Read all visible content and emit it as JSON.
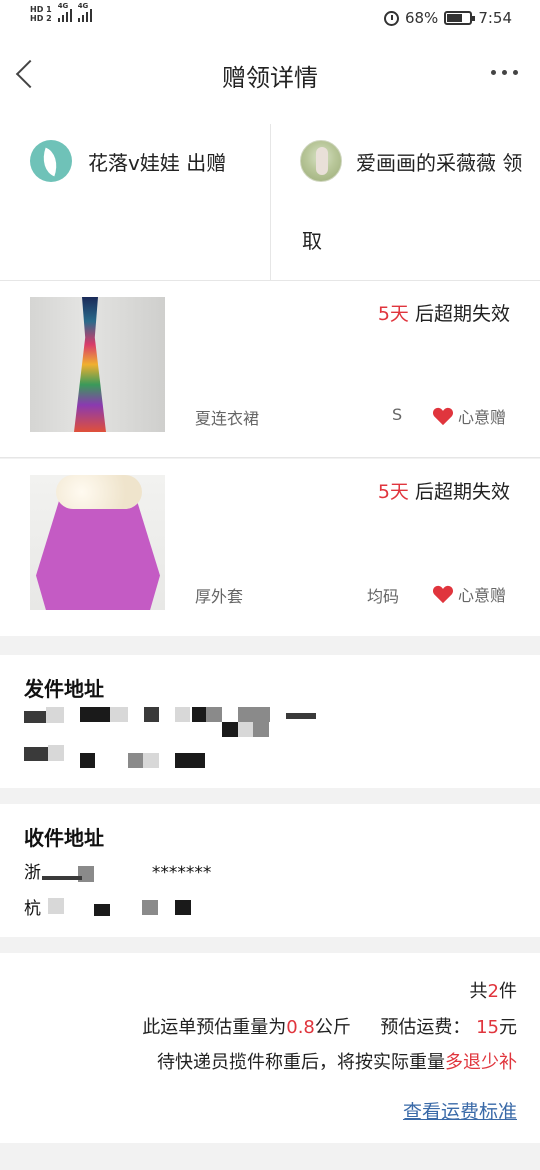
{
  "status": {
    "hd1": "HD 1",
    "hd2": "HD 2",
    "net1": "4G",
    "net2": "4G",
    "battery": "68%",
    "battery_level": 0.68,
    "time": "7:54"
  },
  "nav": {
    "title": "赠领详情"
  },
  "giver": {
    "name": "花落v娃娃",
    "action": "出赠"
  },
  "receiver": {
    "name": "爱画画的采薇薇",
    "action_part1": "领",
    "action_part2": "取"
  },
  "items": [
    {
      "days": "5天",
      "expire_text": "后超期失效",
      "name": "夏连衣裙",
      "size": "S",
      "gift_label": "心意赠"
    },
    {
      "days": "5天",
      "expire_text": "后超期失效",
      "name": "厚外套",
      "size": "均码",
      "gift_label": "心意赠"
    }
  ],
  "send_address": {
    "title": "发件地址"
  },
  "receive_address": {
    "title": "收件地址",
    "line1_visible": "浙",
    "line1_masked": "*******",
    "line2_visible": "杭"
  },
  "summary": {
    "count_prefix": "共",
    "count": "2",
    "count_suffix": "件",
    "weight_prefix": "此运单预估重量为",
    "weight": "0.8",
    "weight_unit": "公斤",
    "fee_label": "预估运费：",
    "fee": "15",
    "fee_unit": "元",
    "note_prefix": "待快递员揽件称重后，将按实际重量",
    "note_highlight": "多退少补",
    "link": "查看运费标准"
  },
  "colors": {
    "accent_red": "#e0353d",
    "link_blue": "#3a6aa8"
  }
}
